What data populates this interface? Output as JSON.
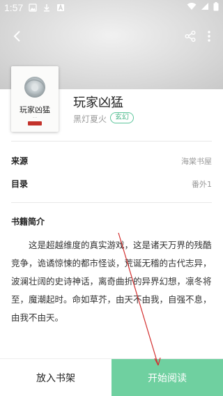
{
  "status_bar": {
    "time": "1:57",
    "icons": [
      "image-icon",
      "download-icon",
      "app-a-icon"
    ],
    "right_icons": [
      "wifi-icon",
      "signal-icon",
      "battery-icon"
    ]
  },
  "header": {
    "back_icon": "back-arrow-icon",
    "share_icon": "share-icon",
    "more_icon": "more-vertical-icon"
  },
  "book": {
    "cover_title": "玩家凶猛",
    "title": "玩家凶猛",
    "author": "黑灯夏火",
    "genre": "玄幻"
  },
  "details": {
    "source_label": "来源",
    "source_value": "海棠书屋",
    "catalog_label": "目录",
    "catalog_value": "番外1"
  },
  "intro": {
    "title": "书籍简介",
    "text": "这是超越维度的真实游戏，这是诸天万界的残酷竞争，诡谲惊悚的都市怪谈，荒诞无稽的古代志异，波澜壮阔的史诗神话，离奇曲折的异界幻想，凛冬将至，魔潮起时。命如草芥，由天不由我，自强不息，由我不由天。"
  },
  "actions": {
    "add_shelf": "放入书架",
    "start_reading": "开始阅读"
  },
  "colors": {
    "accent": "#6fd0a0",
    "tag": "#4cb688",
    "annotation_arrow": "#d32f2f"
  }
}
